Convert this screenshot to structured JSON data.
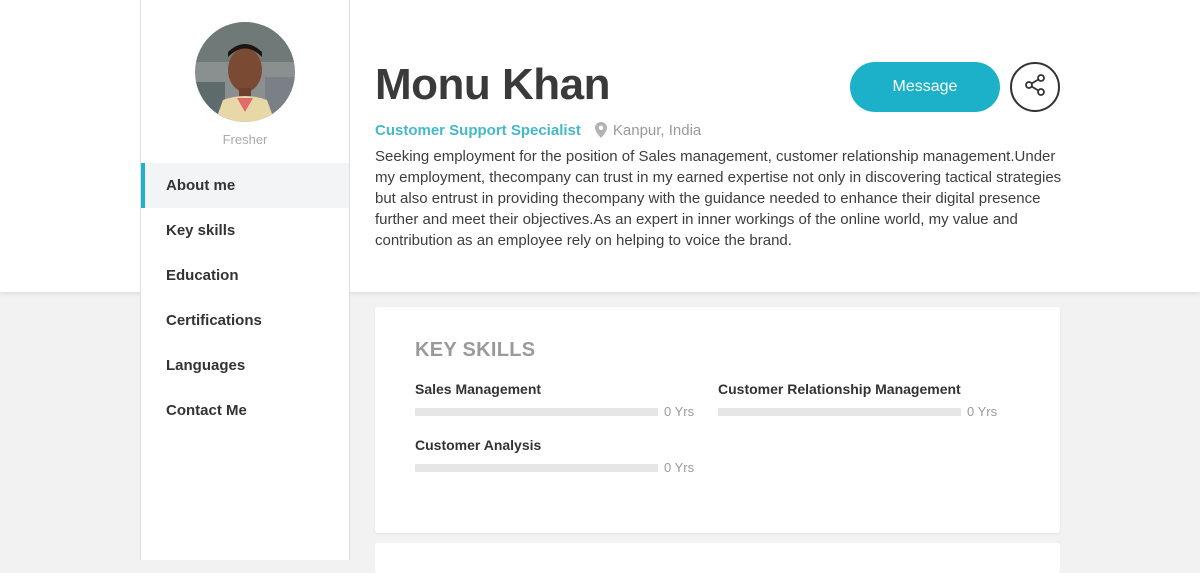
{
  "profile": {
    "name": "Monu Khan",
    "role": "Customer Support Specialist",
    "location": "Kanpur, India",
    "status": "Fresher",
    "about": "Seeking employment for the position of Sales management, customer relationship management.Under my employment, thecompany can trust in my earned expertise not only in discovering tactical strategies but also entrust in providing thecompany with the guidance needed to enhance their digital presence further and meet their objectives.As an expert in inner workings of the online world, my value and contribution as an employee rely on helping to voice the brand."
  },
  "actions": {
    "message_label": "Message",
    "share_icon": "share-icon"
  },
  "sidebar": {
    "items": [
      {
        "label": "About me",
        "active": true
      },
      {
        "label": "Key skills",
        "active": false
      },
      {
        "label": "Education",
        "active": false
      },
      {
        "label": "Certifications",
        "active": false
      },
      {
        "label": "Languages",
        "active": false
      },
      {
        "label": "Contact Me",
        "active": false
      }
    ]
  },
  "key_skills": {
    "title": "KEY SKILLS",
    "items": [
      {
        "name": "Sales Management",
        "years": "0 Yrs",
        "level": 0
      },
      {
        "name": "Customer Relationship Management",
        "years": "0 Yrs",
        "level": 0
      },
      {
        "name": "Customer Analysis",
        "years": "0 Yrs",
        "level": 0
      }
    ]
  },
  "colors": {
    "accent": "#1cb1c9",
    "role_text": "#43b9c9",
    "page_bg": "#f2f2f2"
  }
}
